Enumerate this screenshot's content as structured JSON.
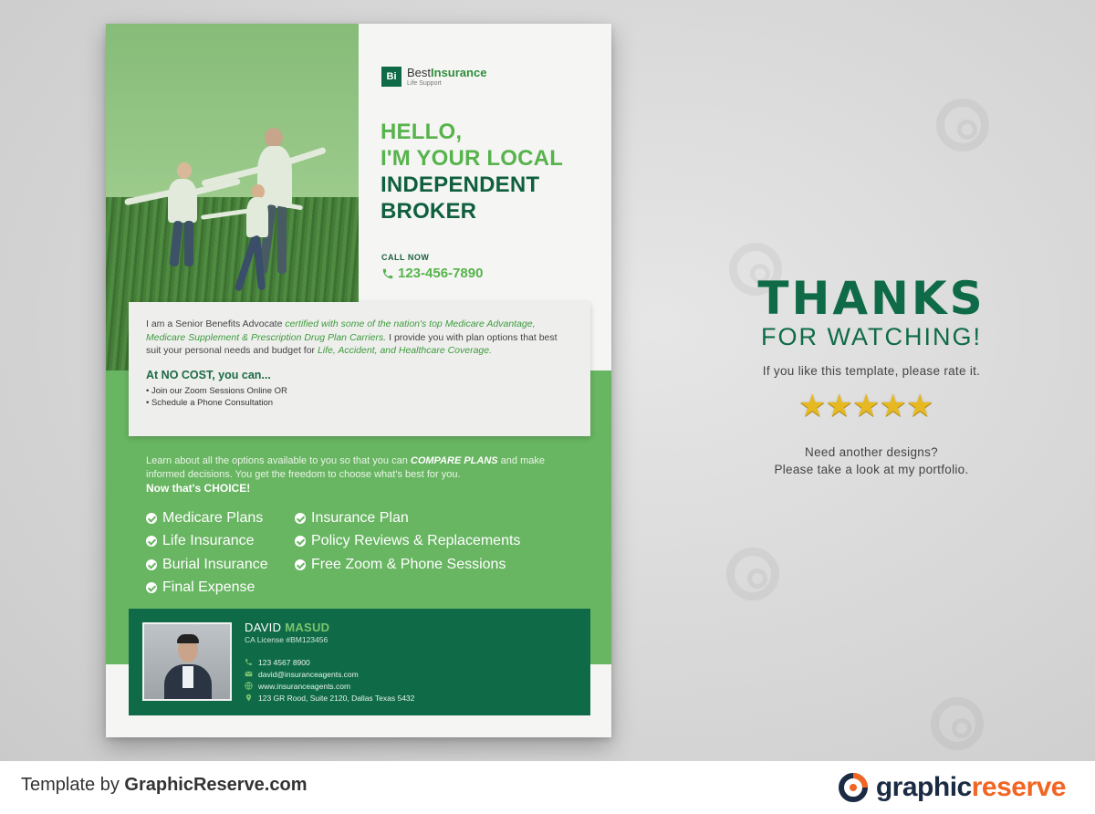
{
  "logo": {
    "mark": "Bi",
    "name_part1": "Best",
    "name_part2": "Insurance",
    "tagline": "Life Support"
  },
  "headline": {
    "line1": "HELLO,",
    "line2": "I'M YOUR LOCAL",
    "line3": "INDEPENDENT",
    "line4": "BROKER"
  },
  "call": {
    "label": "CALL NOW",
    "phone": "123-456-7890"
  },
  "intro": {
    "part1": "I am a Senior Benefits Advocate ",
    "highlight1": "certified with some of the nation's top Medicare Advantage, Medicare Supplement & Prescription Drug Plan Carriers.",
    "part2": " I provide you with plan options that best suit your personal needs and budget for ",
    "highlight2": "Life, Accident, and Healthcare Coverage.",
    "no_cost_title": "At NO COST, you can...",
    "bullets": [
      "Join our Zoom Sessions Online OR",
      "Schedule a Phone Consultation"
    ]
  },
  "learn": {
    "part1": "Learn about all the options available to you so that you can ",
    "highlight": "COMPARE PLANS",
    "part2": " and make informed decisions. You get the freedom to choose what's best for you.",
    "choice": "Now that's CHOICE!"
  },
  "features": {
    "col1": [
      "Medicare Plans",
      "Life Insurance",
      "Burial Insurance",
      "Final Expense"
    ],
    "col2": [
      "Insurance Plan",
      "Policy Reviews & Replacements",
      "Free Zoom & Phone Sessions"
    ]
  },
  "agent": {
    "first_name": "DAVID",
    "last_name": "MASUD",
    "license": "CA License #BM123456",
    "phone": "123 4567 8900",
    "email": "david@insuranceagents.com",
    "website": "www.insuranceagents.com",
    "address": "123 GR Rood, Suite 2120, Dallas Texas 5432"
  },
  "thanks": {
    "title": "THANKS",
    "subtitle": "FOR WATCHING!",
    "rate": "If you like this template, please rate it.",
    "rating": 5,
    "another_line1": "Need another designs?",
    "another_line2": "Please take a look at my portfolio."
  },
  "footer": {
    "template_by": "Template by ",
    "site": "GraphicReserve.com",
    "brand_part1": "graphic",
    "brand_part2": "reserve"
  },
  "colors": {
    "dark_green": "#0f6b47",
    "light_green": "#68b562",
    "accent_orange": "#f26522",
    "star_gold": "#e6b821"
  },
  "icons": [
    "phone-icon",
    "check-icon",
    "mail-icon",
    "globe-icon",
    "map-pin-icon",
    "star-icon",
    "brand-logo-icon"
  ]
}
